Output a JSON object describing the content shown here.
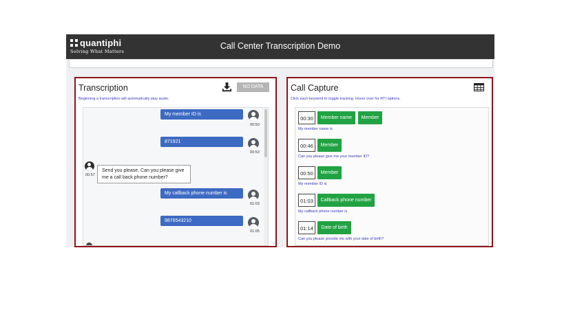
{
  "header": {
    "brand": "quantiphi",
    "tagline": "Solving What Matters",
    "title": "Call Center Transcription Demo"
  },
  "transcription": {
    "heading": "Transcription",
    "subtitle": "Beginning a transcription will automatically play audio.",
    "no_data_label": "NO DATA",
    "messages": [
      {
        "speaker": "agent",
        "text": "My member ID is",
        "time": "00:50"
      },
      {
        "speaker": "agent",
        "text": "871921",
        "time": "00:53"
      },
      {
        "speaker": "caller",
        "text": "Send you please, Can you please give me a call back phone number?",
        "time": "00:57"
      },
      {
        "speaker": "agent",
        "text": "My callback phone number is",
        "time": "01:03"
      },
      {
        "speaker": "agent",
        "text": "9876543210",
        "time": "01:05"
      }
    ]
  },
  "call_capture": {
    "heading": "Call Capture",
    "subtitle": "Click each keyword to toggle tracking. Hover over for RTI options.",
    "entries": [
      {
        "time": "00:30",
        "keywords": [
          "Member name",
          "Member"
        ],
        "text": "My member name is"
      },
      {
        "time": "00:46",
        "keywords": [
          "Member"
        ],
        "text": "Can you please give me your member ID?"
      },
      {
        "time": "00:50",
        "keywords": [
          "Member"
        ],
        "text": "My member ID is"
      },
      {
        "time": "01:03",
        "keywords": [
          "Callback phone number"
        ],
        "text": "My callback phone number is"
      },
      {
        "time": "01:14",
        "keywords": [
          "Date of birth"
        ],
        "text": "Can you please provide me with your date of birth?"
      }
    ]
  },
  "colors": {
    "header_bg": "#333333",
    "panel_border": "#8b1318",
    "agent_bubble": "#3d6ac2",
    "keyword_green": "#21a243",
    "subtitle_blue": "#3a3ab8"
  },
  "icons": [
    "download-icon",
    "table-grid-icon",
    "user-avatar-icon"
  ]
}
